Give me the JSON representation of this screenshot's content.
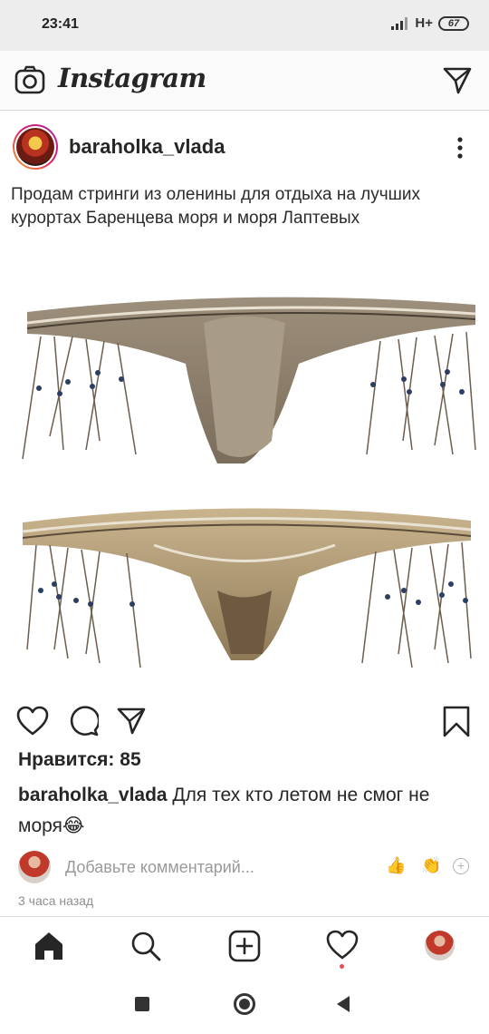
{
  "status_bar": {
    "time": "23:41",
    "network": "H+",
    "battery": "67"
  },
  "header": {
    "logo_text": "Instagram"
  },
  "post": {
    "username": "baraholka_vlada",
    "image_text": "Продам стринги из оленины для отдыха на лучших курортах Баренцева моря и моря Лаптевых",
    "likes": "Нравится: 85",
    "caption_user": "baraholka_vlada",
    "caption_text": " Для тех кто летом не смог не моря😂",
    "comment_placeholder": "Добавьте комментарий...",
    "quick_emojis": [
      "👍",
      "👏"
    ],
    "time_ago": "3 часа назад"
  },
  "colors": {
    "notification_dot": "#ed4956",
    "text": "#262626",
    "muted": "#8e8e8e"
  }
}
